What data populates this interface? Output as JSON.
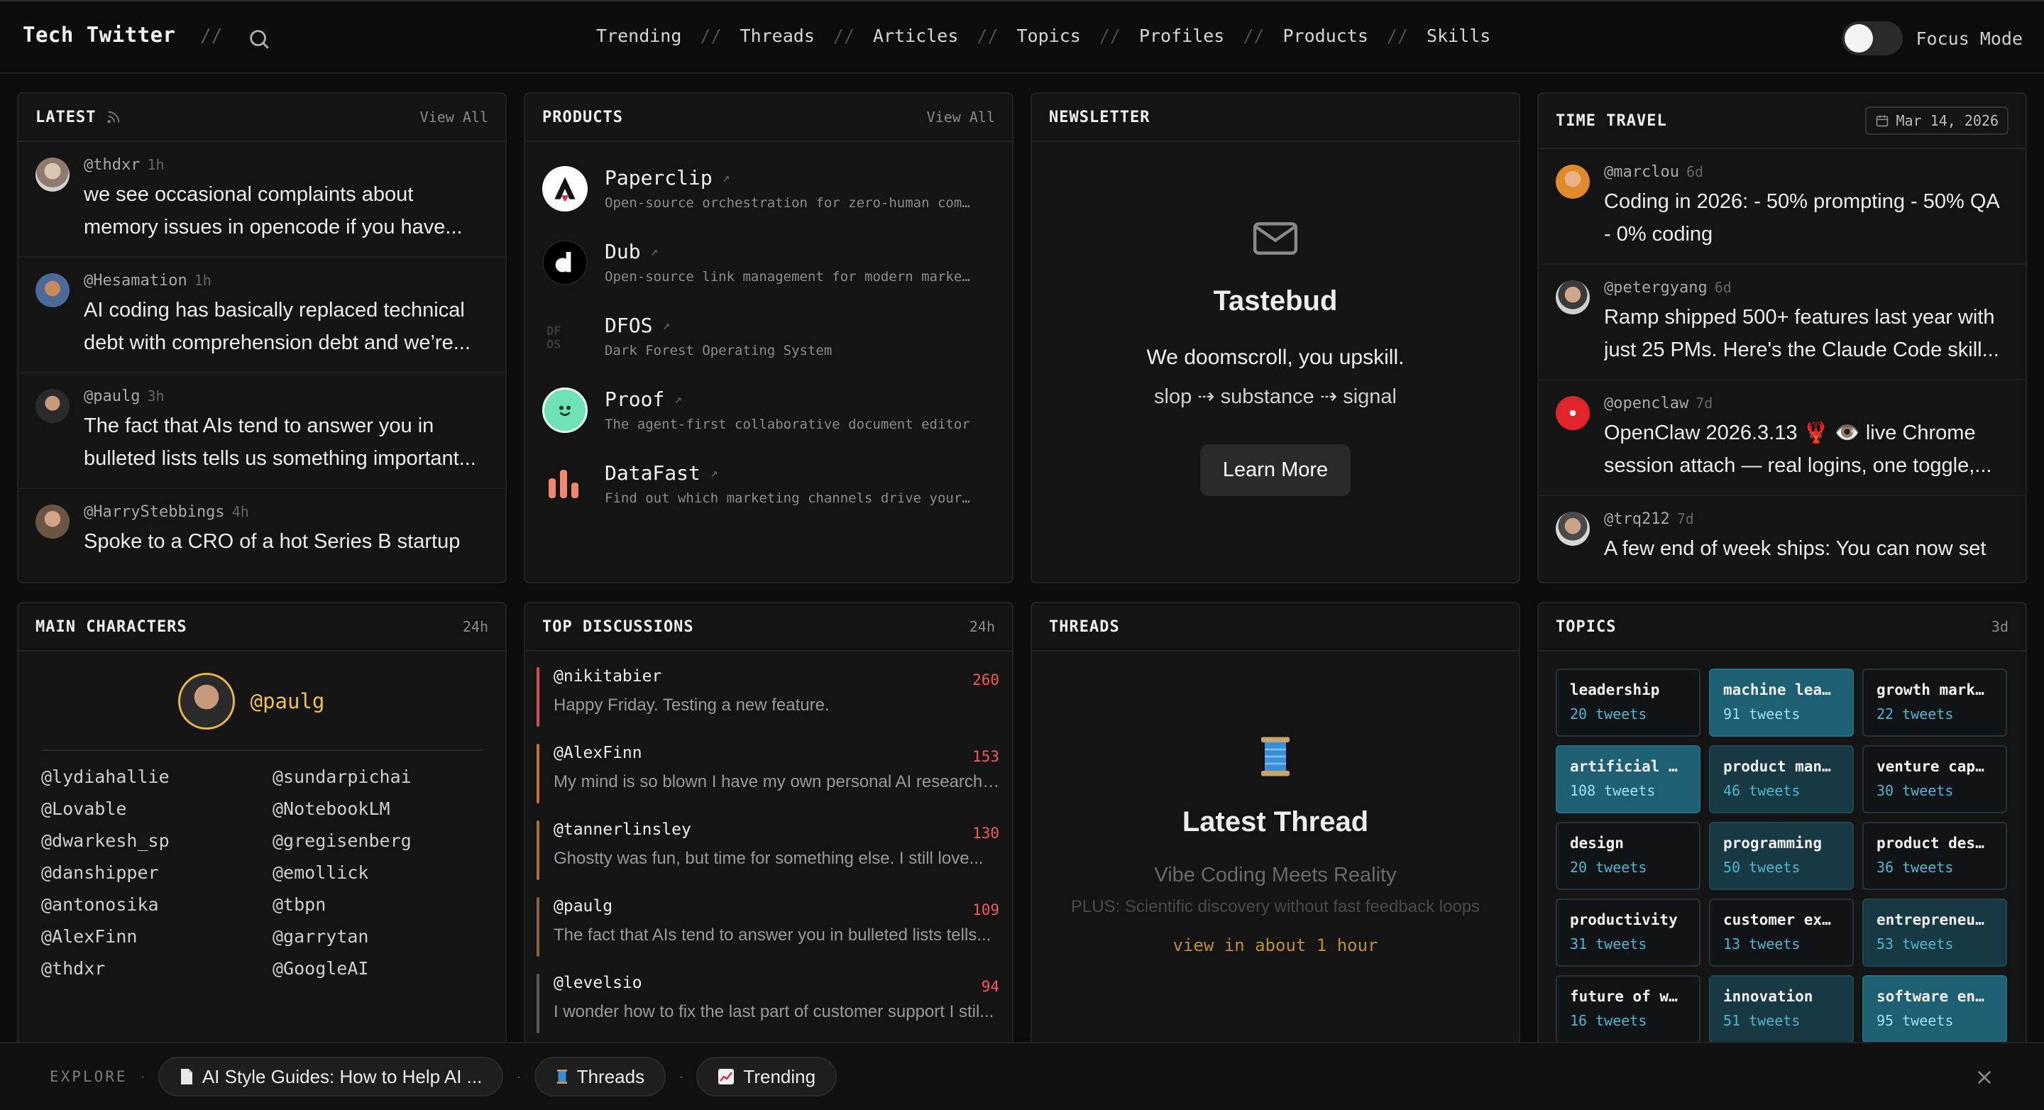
{
  "nav": {
    "brand": "Tech Twitter",
    "brand_sep": "//",
    "links": [
      "Trending",
      "Threads",
      "Articles",
      "Topics",
      "Profiles",
      "Products",
      "Skills"
    ],
    "sep": "//",
    "focus_label": "Focus Mode"
  },
  "latest": {
    "title": "LATEST",
    "view_all": "View All",
    "tweets": [
      {
        "handle": "@thdxr",
        "time": "1h",
        "text": "we see occasional complaints about memory issues in opencode if you have..."
      },
      {
        "handle": "@Hesamation",
        "time": "1h",
        "text": "AI coding has basically replaced technical debt with comprehension debt and we’re..."
      },
      {
        "handle": "@paulg",
        "time": "3h",
        "text": "The fact that AIs tend to answer you in bulleted lists tells us something important..."
      },
      {
        "handle": "@HarryStebbings",
        "time": "4h",
        "text": "Spoke to a CRO of a hot Series B startup"
      }
    ]
  },
  "products": {
    "title": "PRODUCTS",
    "view_all": "View All",
    "items": [
      {
        "name": "Paperclip",
        "desc": "Open-source orchestration for zero-human com…"
      },
      {
        "name": "Dub",
        "desc": "Open-source link management for modern marke…"
      },
      {
        "name": "DFOS",
        "desc": "Dark Forest Operating System"
      },
      {
        "name": "Proof",
        "desc": "The agent-first collaborative document editor"
      },
      {
        "name": "DataFast",
        "desc": "Find out which marketing channels drive your…"
      }
    ],
    "arrow": "↗"
  },
  "newsletter": {
    "title": "NEWSLETTER",
    "name": "Tastebud",
    "tagline": "We doomscroll, you upskill.",
    "flow": "slop ⇢ substance ⇢ signal",
    "button": "Learn More"
  },
  "time_travel": {
    "title": "TIME TRAVEL",
    "date": "Mar 14, 2026",
    "tweets": [
      {
        "handle": "@marclou",
        "time": "6d",
        "text": "Coding in 2026: - 50% prompting - 50% QA - 0% coding"
      },
      {
        "handle": "@petergyang",
        "time": "6d",
        "text": "Ramp shipped 500+ features last year with just 25 PMs. Here's the Claude Code skill..."
      },
      {
        "handle": "@openclaw",
        "time": "7d",
        "text": "OpenClaw 2026.3.13 🦞 👁️ live Chrome session attach — real logins, one toggle,..."
      },
      {
        "handle": "@trq212",
        "time": "7d",
        "text": "A few end of week ships: You can now set"
      }
    ]
  },
  "main_characters": {
    "title": "MAIN CHARACTERS",
    "range": "24h",
    "featured": "@paulg",
    "left": [
      "@lydiahallie",
      "@Lovable",
      "@dwarkesh_sp",
      "@danshipper",
      "@antonosika",
      "@AlexFinn",
      "@thdxr"
    ],
    "right": [
      "@sundarpichai",
      "@NotebookLM",
      "@gregisenberg",
      "@emollick",
      "@tbpn",
      "@garrytan",
      "@GoogleAI"
    ]
  },
  "discussions": {
    "title": "TOP DISCUSSIONS",
    "range": "24h",
    "items": [
      {
        "handle": "@nikitabier",
        "count": "260",
        "text": "Happy Friday. Testing a new feature.",
        "color": "#d94b4b"
      },
      {
        "handle": "@AlexFinn",
        "count": "153",
        "text": "My mind is so blown I have my own personal AI research l...",
        "color": "#c9702c"
      },
      {
        "handle": "@tannerlinsley",
        "count": "130",
        "text": "Ghostty was fun, but time for something else. I still love...",
        "color": "#a8702f"
      },
      {
        "handle": "@paulg",
        "count": "109",
        "text": "The fact that AIs tend to answer you in bulleted lists tells...",
        "color": "#8a6434"
      },
      {
        "handle": "@levelsio",
        "count": "94",
        "text": "I wonder how to fix the last part of customer support I stil...",
        "color": "#5a5a5a"
      }
    ]
  },
  "threads": {
    "title": "THREADS",
    "heading": "Latest Thread",
    "subject": "Vibe Coding Meets Reality",
    "plus": "PLUS: Scientific discovery without fast feedback loops",
    "cta": "view in about 1 hour"
  },
  "topics": {
    "title": "TOPICS",
    "range": "3d",
    "items": [
      {
        "name": "leadership",
        "count": "20 tweets",
        "level": "none"
      },
      {
        "name": "machine learn…",
        "count": "91 tweets",
        "level": "hi"
      },
      {
        "name": "growth market…",
        "count": "22 tweets",
        "level": "none"
      },
      {
        "name": "artificial in…",
        "count": "108 tweets",
        "level": "hi"
      },
      {
        "name": "product manag…",
        "count": "46 tweets",
        "level": "lo"
      },
      {
        "name": "venture capit…",
        "count": "30 tweets",
        "level": "none"
      },
      {
        "name": "design",
        "count": "20 tweets",
        "level": "none"
      },
      {
        "name": "programming",
        "count": "50 tweets",
        "level": "lo"
      },
      {
        "name": "product design",
        "count": "36 tweets",
        "level": "none"
      },
      {
        "name": "productivity",
        "count": "31 tweets",
        "level": "none"
      },
      {
        "name": "customer expe…",
        "count": "13 tweets",
        "level": "none"
      },
      {
        "name": "entrepreneurs…",
        "count": "53 tweets",
        "level": "lo"
      },
      {
        "name": "future of work",
        "count": "16 tweets",
        "level": "none"
      },
      {
        "name": "innovation",
        "count": "51 tweets",
        "level": "lo"
      },
      {
        "name": "software engi…",
        "count": "95 tweets",
        "level": "hi"
      }
    ]
  },
  "explore": {
    "label": "EXPLORE",
    "chips": [
      "AI Style Guides: How to Help AI ...",
      "Threads",
      "Trending"
    ]
  }
}
